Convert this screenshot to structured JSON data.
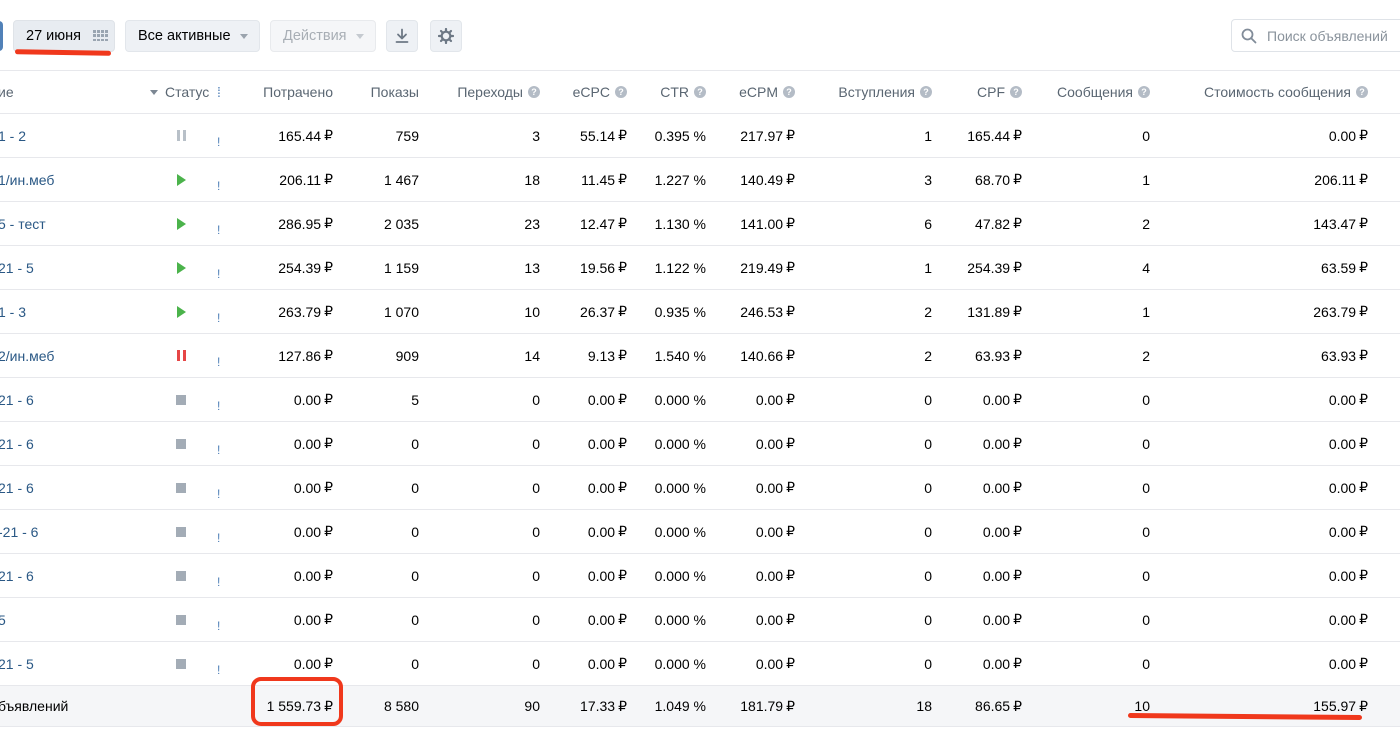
{
  "toolbar": {
    "date_label": "27 июня",
    "filter_label": "Все активные",
    "actions_label": "Действия",
    "search_placeholder": "Поиск объявлений"
  },
  "icons": {
    "calendar": "calendar-grid-icon",
    "download": "download-icon",
    "settings": "gear-icon",
    "search": "search-icon"
  },
  "colors": {
    "link": "#2a5885",
    "play": "#4bb34b",
    "pause_active": "#e64646",
    "annotation": "#f0381c"
  },
  "table": {
    "headers": {
      "name": "ие",
      "status": "Статус",
      "spent": "Потрачено",
      "views": "Показы",
      "clicks": "Переходы",
      "ecpc": "eCPC",
      "ctr": "CTR",
      "ecpm": "eCPM",
      "joins": "Вступления",
      "cpf": "CPF",
      "messages": "Сообщения",
      "msg_cost": "Стоимость сообщения"
    },
    "currency": "₽",
    "rows": [
      {
        "name": "1 - 2",
        "status": "paused",
        "spent": "165.44",
        "views": "759",
        "clicks": "3",
        "ecpc": "55.14",
        "ctr": "0.395 %",
        "ecpm": "217.97",
        "joins": "1",
        "cpf": "165.44",
        "messages": "0",
        "msg_cost": "0.00"
      },
      {
        "name": "1/ин.меб",
        "status": "running",
        "spent": "206.11",
        "views": "1 467",
        "clicks": "18",
        "ecpc": "11.45",
        "ctr": "1.227 %",
        "ecpm": "140.49",
        "joins": "3",
        "cpf": "68.70",
        "messages": "1",
        "msg_cost": "206.11"
      },
      {
        "name": "5 - тест",
        "status": "running",
        "spent": "286.95",
        "views": "2 035",
        "clicks": "23",
        "ecpc": "12.47",
        "ctr": "1.130 %",
        "ecpm": "141.00",
        "joins": "6",
        "cpf": "47.82",
        "messages": "2",
        "msg_cost": "143.47"
      },
      {
        "name": "21 - 5",
        "status": "running",
        "spent": "254.39",
        "views": "1 159",
        "clicks": "13",
        "ecpc": "19.56",
        "ctr": "1.122 %",
        "ecpm": "219.49",
        "joins": "1",
        "cpf": "254.39",
        "messages": "4",
        "msg_cost": "63.59"
      },
      {
        "name": "1 - 3",
        "status": "running",
        "spent": "263.79",
        "views": "1 070",
        "clicks": "10",
        "ecpc": "26.37",
        "ctr": "0.935 %",
        "ecpm": "246.53",
        "joins": "2",
        "cpf": "131.89",
        "messages": "1",
        "msg_cost": "263.79"
      },
      {
        "name": "2/ин.меб",
        "status": "paused-red",
        "spent": "127.86",
        "views": "909",
        "clicks": "14",
        "ecpc": "9.13",
        "ctr": "1.540 %",
        "ecpm": "140.66",
        "joins": "2",
        "cpf": "63.93",
        "messages": "2",
        "msg_cost": "63.93"
      },
      {
        "name": "21 - 6",
        "status": "stopped",
        "spent": "0.00",
        "views": "5",
        "clicks": "0",
        "ecpc": "0.00",
        "ctr": "0.000 %",
        "ecpm": "0.00",
        "joins": "0",
        "cpf": "0.00",
        "messages": "0",
        "msg_cost": "0.00"
      },
      {
        "name": "21 - 6",
        "status": "stopped",
        "spent": "0.00",
        "views": "0",
        "clicks": "0",
        "ecpc": "0.00",
        "ctr": "0.000 %",
        "ecpm": "0.00",
        "joins": "0",
        "cpf": "0.00",
        "messages": "0",
        "msg_cost": "0.00"
      },
      {
        "name": "21 - 6",
        "status": "stopped",
        "spent": "0.00",
        "views": "0",
        "clicks": "0",
        "ecpc": "0.00",
        "ctr": "0.000 %",
        "ecpm": "0.00",
        "joins": "0",
        "cpf": "0.00",
        "messages": "0",
        "msg_cost": "0.00"
      },
      {
        "name": "-21 - 6",
        "status": "stopped",
        "spent": "0.00",
        "views": "0",
        "clicks": "0",
        "ecpc": "0.00",
        "ctr": "0.000 %",
        "ecpm": "0.00",
        "joins": "0",
        "cpf": "0.00",
        "messages": "0",
        "msg_cost": "0.00"
      },
      {
        "name": "21 - 6",
        "status": "stopped",
        "spent": "0.00",
        "views": "0",
        "clicks": "0",
        "ecpc": "0.00",
        "ctr": "0.000 %",
        "ecpm": "0.00",
        "joins": "0",
        "cpf": "0.00",
        "messages": "0",
        "msg_cost": "0.00"
      },
      {
        "name": "5",
        "status": "stopped",
        "spent": "0.00",
        "views": "0",
        "clicks": "0",
        "ecpc": "0.00",
        "ctr": "0.000 %",
        "ecpm": "0.00",
        "joins": "0",
        "cpf": "0.00",
        "messages": "0",
        "msg_cost": "0.00"
      },
      {
        "name": "21 - 5",
        "status": "stopped",
        "spent": "0.00",
        "views": "0",
        "clicks": "0",
        "ecpc": "0.00",
        "ctr": "0.000 %",
        "ecpm": "0.00",
        "joins": "0",
        "cpf": "0.00",
        "messages": "0",
        "msg_cost": "0.00"
      }
    ],
    "total": {
      "label": "бъявлений",
      "spent": "1 559.73",
      "views": "8 580",
      "clicks": "90",
      "ecpc": "17.33",
      "ctr": "1.049 %",
      "ecpm": "181.79",
      "joins": "18",
      "cpf": "86.65",
      "messages": "10",
      "msg_cost": "155.97"
    }
  }
}
